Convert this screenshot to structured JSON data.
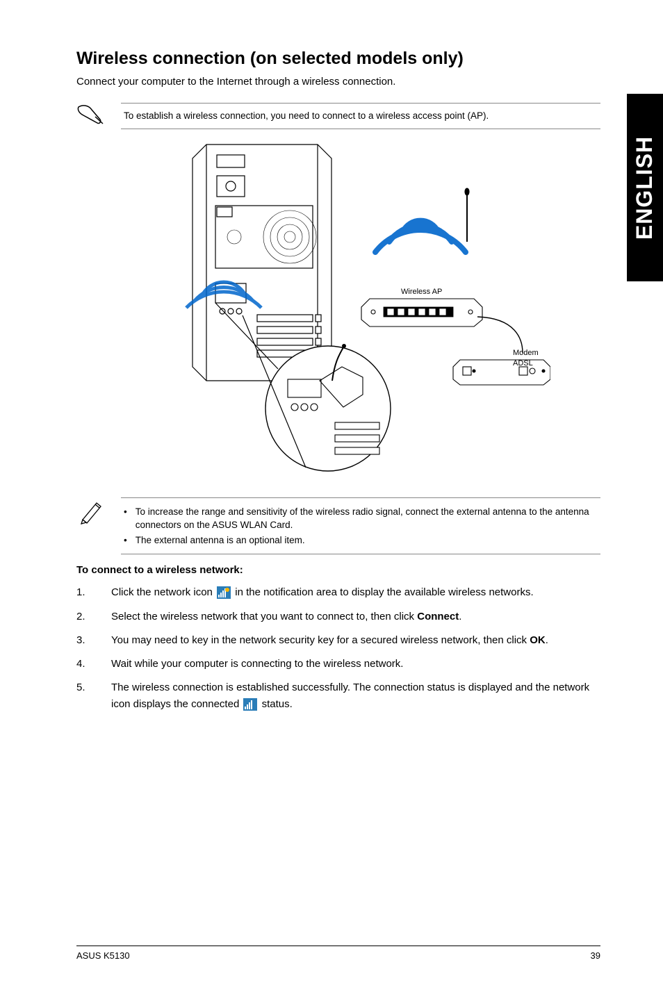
{
  "sidebar_language": "ENGLISH",
  "title": "Wireless connection (on selected models only)",
  "intro": "Connect your computer to the Internet through a wireless connection.",
  "note1": "To establish a wireless connection, you need to connect to a wireless access point (AP).",
  "diagram": {
    "wireless_ap_label": "Wireless AP",
    "modem_label": "Modem",
    "adsl_label": "ADSL"
  },
  "note2_items": [
    "To increase the range and sensitivity of the wireless radio signal, connect the external antenna to the antenna connectors on the ASUS WLAN Card.",
    "The external antenna is an optional item."
  ],
  "subheading": "To connect to a wireless network:",
  "steps": [
    {
      "num": "1.",
      "pre": "Click the network icon ",
      "post": " in the notification area to display the available wireless networks.",
      "icon": "available"
    },
    {
      "num": "2.",
      "text": "Select the wireless network that you want to connect to, then click ",
      "bold": "Connect",
      "tail": "."
    },
    {
      "num": "3.",
      "text": "You may need to key in the network security key for a secured wireless network, then click ",
      "bold": "OK",
      "tail": "."
    },
    {
      "num": "4.",
      "text": "Wait while your computer is connecting to the wireless network."
    },
    {
      "num": "5.",
      "pre": "The wireless connection is established successfully. The connection status is displayed and the network icon displays the connected ",
      "post": " status.",
      "icon": "connected"
    }
  ],
  "footer": {
    "product": "ASUS K5130",
    "page": "39"
  }
}
